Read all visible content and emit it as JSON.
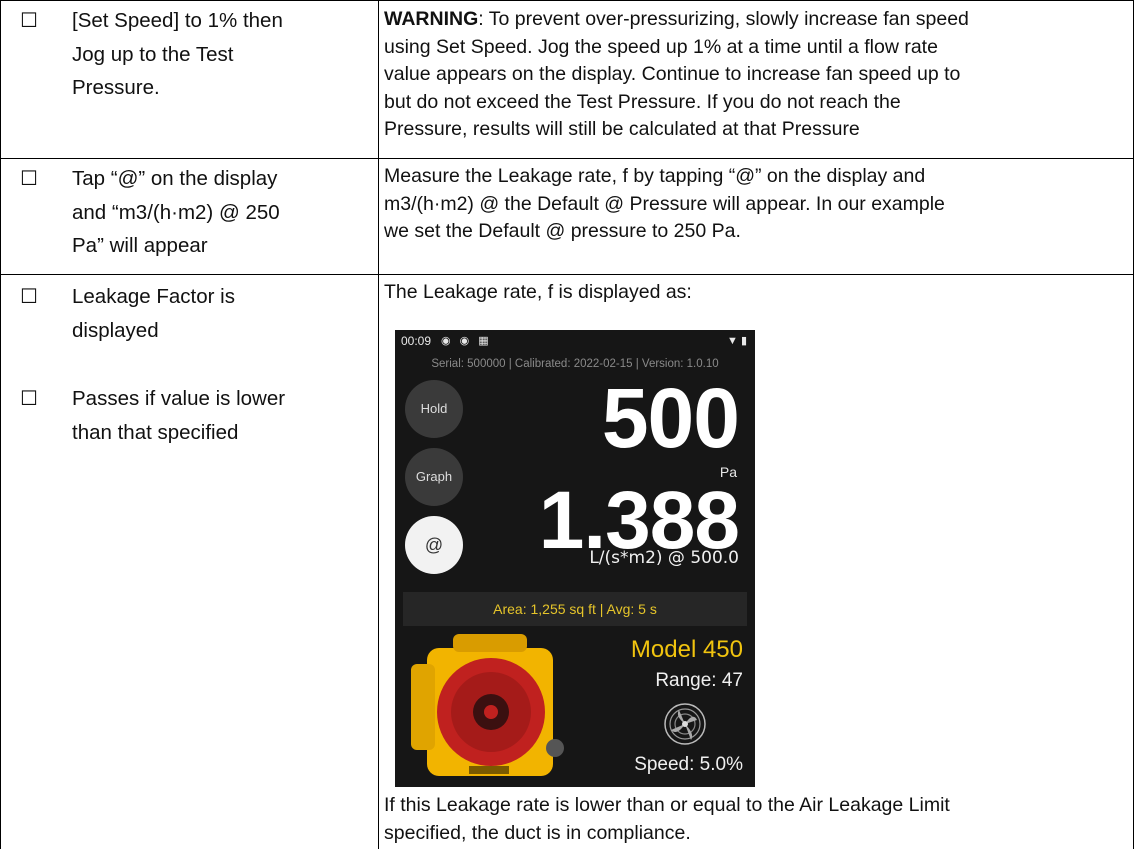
{
  "steps": [
    {
      "checkbox": "☐",
      "step_lines": [
        "[Set Speed] to 1% then",
        "Jog up to the Test",
        "Pressure."
      ],
      "warning_label": "WARNING",
      "detail_lines": [
        ": To prevent over-pressurizing, slowly increase fan speed",
        "using Set Speed.  Jog the speed up 1% at a time until a flow rate",
        "value appears on the display.  Continue to increase fan speed up to",
        "but do not exceed the Test Pressure.  If you do not reach the",
        "Pressure, results will still be calculated at that Pressure"
      ]
    },
    {
      "checkbox": "☐",
      "step_lines": [
        "Tap “@” on the display",
        "and “m3/(h·m2) @ 250",
        "Pa” will appear"
      ],
      "detail_lines": [
        "Measure the Leakage rate, f by tapping “@” on the display and",
        "m3/(h·m2) @ the Default @ Pressure will appear.  In our example",
        "we set the Default @ pressure to 250 Pa."
      ]
    },
    {
      "checkbox_a": "☐",
      "step_a_lines": [
        "Leakage Factor is",
        "displayed"
      ],
      "checkbox_b": "☐",
      "step_b_lines": [
        "Passes if value is lower",
        "than that specified"
      ],
      "detail_intro": "The Leakage rate, f is displayed as:",
      "detail_after_lines": [
        "If this Leakage rate is lower than or equal to the Air Leakage Limit",
        "specified, the duct is in compliance."
      ]
    }
  ],
  "device_screen": {
    "time": "00:09",
    "serial_line": "Serial: 500000 | Calibrated: 2022-02-15 | Version: 1.0.10",
    "hold_label": "Hold",
    "graph_label": "Graph",
    "at_label": "@",
    "pressure_value": "500",
    "pressure_unit": "Pa",
    "rate_value": "1.388",
    "rate_unit": "L/(s*m2) @ 500.0",
    "area_line": "Area: 1,255 sq ft | Avg: 5 s",
    "model": "Model 450",
    "range": "Range: 47",
    "speed": "Speed: 5.0%",
    "colors": {
      "background": "#161616",
      "accent": "#f1c40f",
      "device_body": "#f2b400",
      "device_face": "#c0211f"
    }
  }
}
